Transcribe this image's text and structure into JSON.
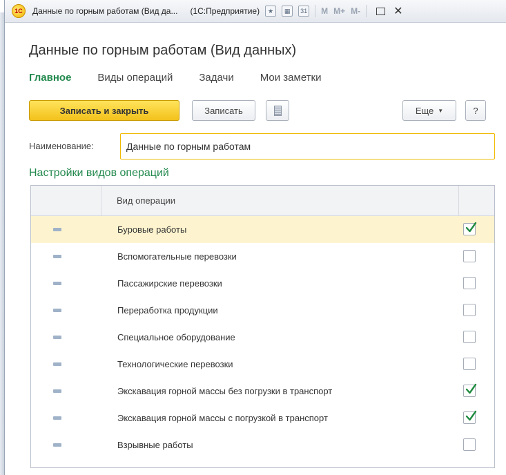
{
  "window": {
    "title": "Данные по горным работам (Вид да...",
    "app_name": "(1С:Предприятие)",
    "logo_text": "1С",
    "mem_labels": [
      "M",
      "M+",
      "M-"
    ]
  },
  "form": {
    "title": "Данные по горным работам (Вид данных)"
  },
  "tabs": [
    {
      "label": "Главное",
      "active": true
    },
    {
      "label": "Виды операций",
      "active": false
    },
    {
      "label": "Задачи",
      "active": false
    },
    {
      "label": "Мои заметки",
      "active": false
    }
  ],
  "toolbar": {
    "save_close_label": "Записать и закрыть",
    "save_label": "Записать",
    "more_label": "Еще",
    "help_label": "?"
  },
  "name_field": {
    "label": "Наименование:",
    "value": "Данные по горным работам"
  },
  "section": {
    "title": "Настройки видов операций"
  },
  "table": {
    "column_header": "Вид операции",
    "rows": [
      {
        "label": "Буровые работы",
        "checked": true,
        "selected": true
      },
      {
        "label": "Вспомогательные перевозки",
        "checked": false,
        "selected": false
      },
      {
        "label": "Пассажирские перевозки",
        "checked": false,
        "selected": false
      },
      {
        "label": "Переработка продукции",
        "checked": false,
        "selected": false
      },
      {
        "label": "Специальное оборудование",
        "checked": false,
        "selected": false
      },
      {
        "label": "Технологические перевозки",
        "checked": false,
        "selected": false
      },
      {
        "label": "Экскавация горной массы без погрузки в транспорт",
        "checked": true,
        "selected": false
      },
      {
        "label": "Экскавация горной массы с погрузкой в транспорт",
        "checked": true,
        "selected": false
      },
      {
        "label": "Взрывные работы",
        "checked": false,
        "selected": false
      }
    ]
  },
  "colors": {
    "accent_green": "#22894d",
    "primary_button": "#f3c11b",
    "selected_row": "#fdf4cf"
  }
}
